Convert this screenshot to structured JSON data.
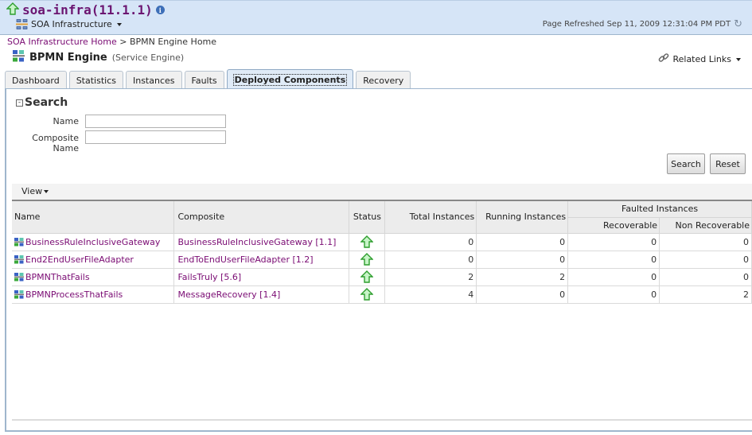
{
  "header": {
    "target_name": "soa-infra(11.1.1)",
    "target_menu_label": "SOA Infrastructure",
    "refresh_text": "Page Refreshed Sep 11, 2009 12:31:04 PM PDT"
  },
  "breadcrumb": {
    "link": "SOA Infrastructure Home",
    "separator": ">",
    "current": "BPMN Engine Home"
  },
  "page": {
    "title": "BPMN Engine",
    "subtitle": "(Service Engine)",
    "related_links": "Related Links"
  },
  "tabs": [
    {
      "label": "Dashboard",
      "active": false
    },
    {
      "label": "Statistics",
      "active": false
    },
    {
      "label": "Instances",
      "active": false
    },
    {
      "label": "Faults",
      "active": false
    },
    {
      "label": "Deployed Components",
      "active": true
    },
    {
      "label": "Recovery",
      "active": false
    }
  ],
  "search": {
    "title": "Search",
    "name_label": "Name",
    "name_value": "",
    "composite_label": "Composite Name",
    "composite_value": "",
    "search_button": "Search",
    "reset_button": "Reset"
  },
  "table": {
    "view_menu": "View",
    "headers": {
      "name": "Name",
      "composite": "Composite",
      "status": "Status",
      "total": "Total Instances",
      "running": "Running Instances",
      "faulted": "Faulted Instances",
      "recoverable": "Recoverable",
      "non_recoverable": "Non Recoverable"
    },
    "rows": [
      {
        "name": "BusinessRuleInclusiveGateway",
        "composite": "BusinessRuleInclusiveGateway [1.1]",
        "status": "up",
        "total": "0",
        "running": "0",
        "recoverable": "0",
        "non_recoverable": "0"
      },
      {
        "name": "End2EndUserFileAdapter",
        "composite": "EndToEndUserFileAdapter [1.2]",
        "status": "up",
        "total": "0",
        "running": "0",
        "recoverable": "0",
        "non_recoverable": "0"
      },
      {
        "name": "BPMNThatFails",
        "composite": "FailsTruly [5.6]",
        "status": "up",
        "total": "2",
        "running": "2",
        "recoverable": "0",
        "non_recoverable": "0"
      },
      {
        "name": "BPMNProcessThatFails",
        "composite": "MessageRecovery [1.4]",
        "status": "up",
        "total": "4",
        "running": "0",
        "recoverable": "0",
        "non_recoverable": "2"
      }
    ]
  },
  "colors": {
    "link": "#7a0b73",
    "header_bg": "#d6e5f7",
    "status_up": "#3fbf3f"
  }
}
